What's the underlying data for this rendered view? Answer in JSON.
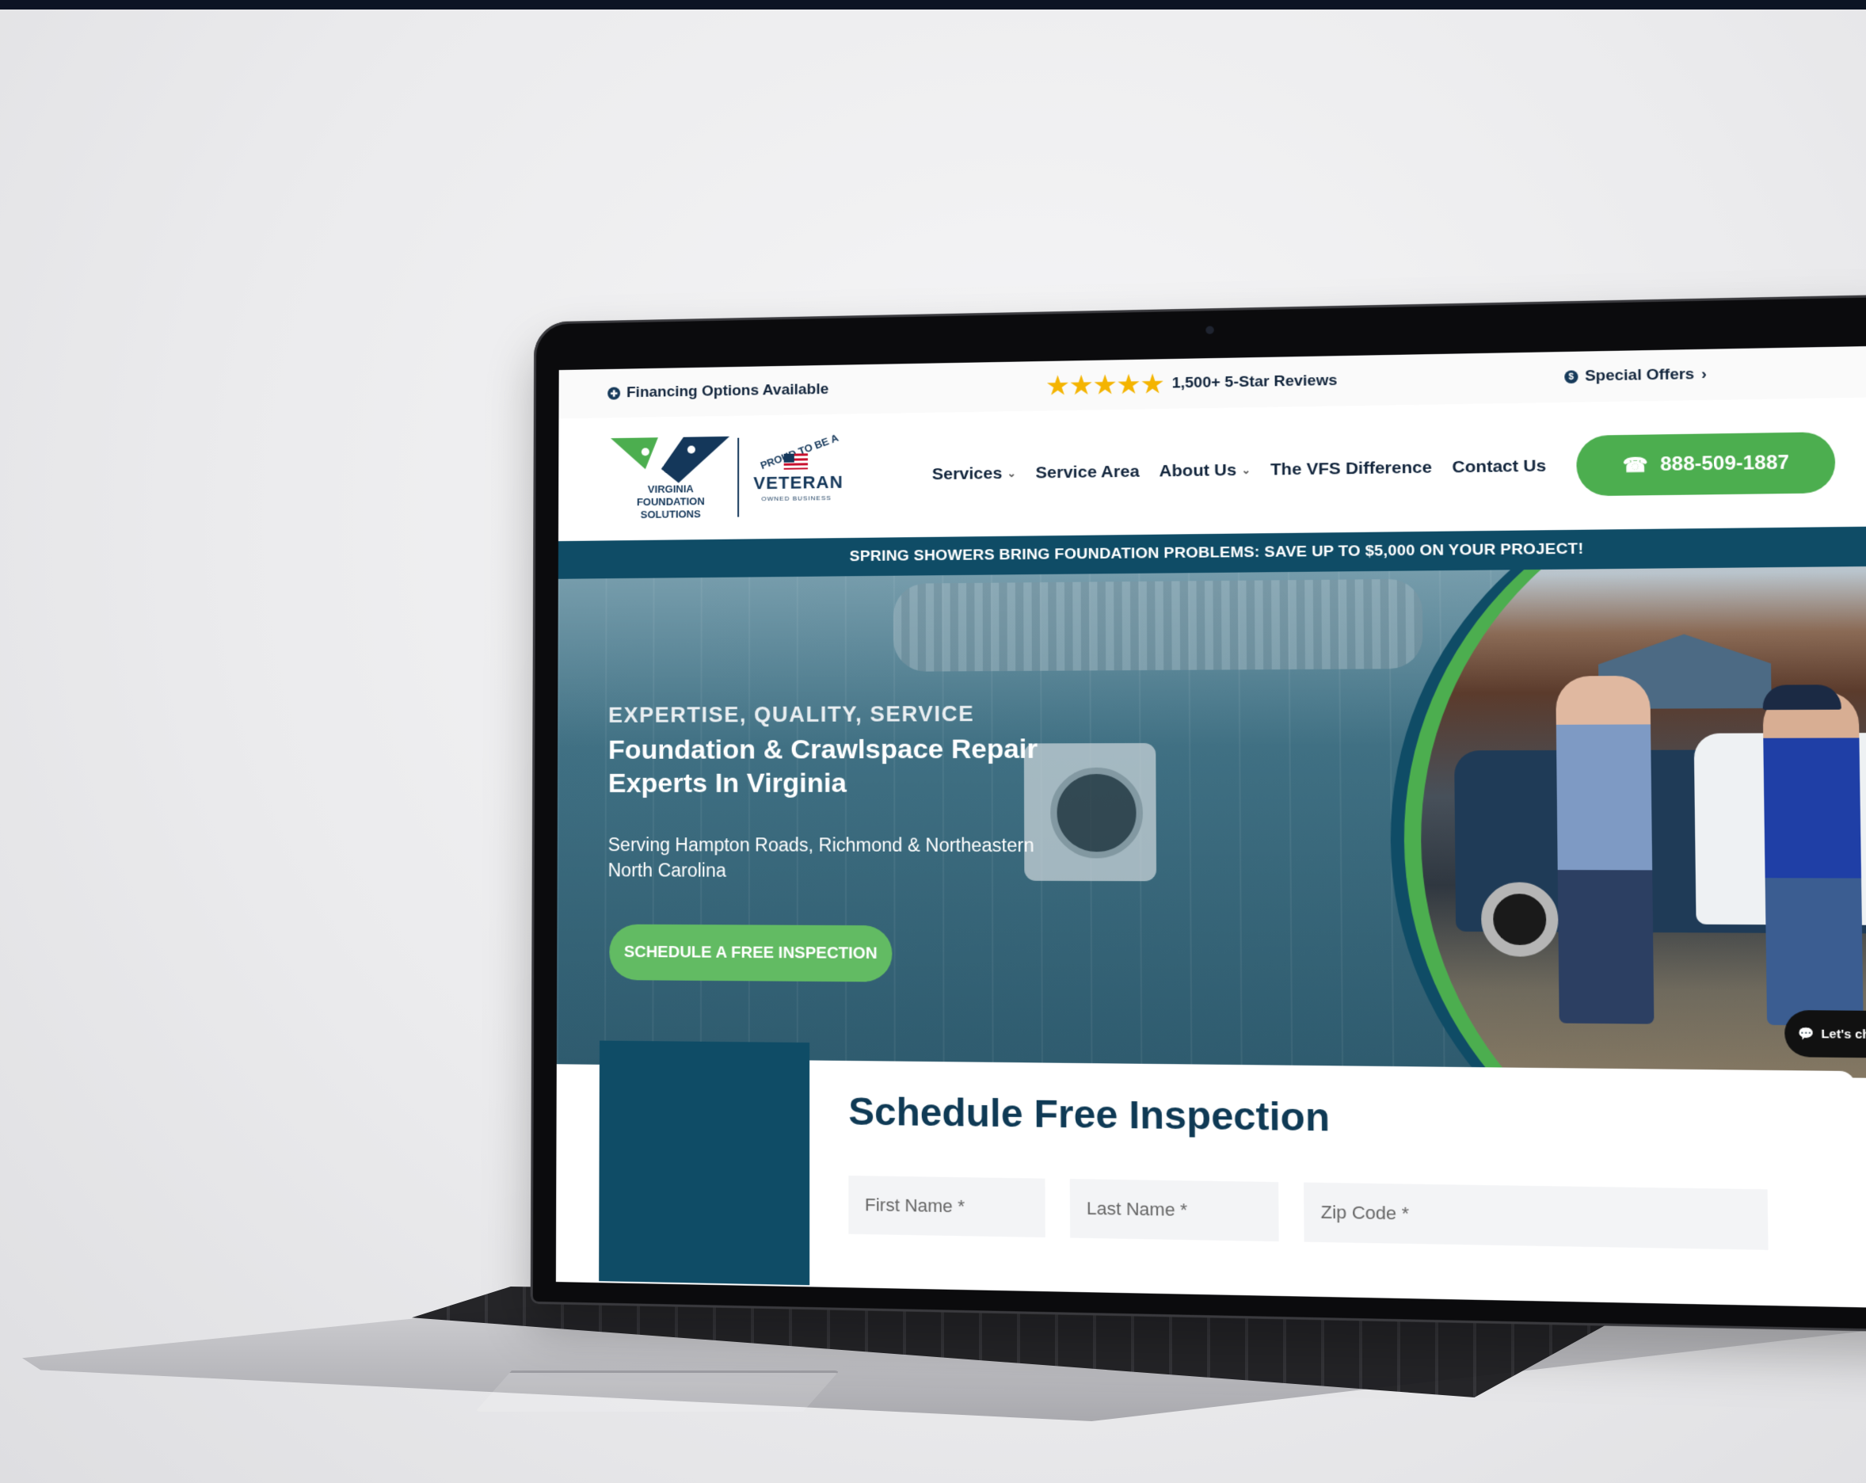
{
  "topbar": {
    "financing": "Financing Options Available",
    "stars": "★★★★★",
    "reviews": "1,500+ 5-Star Reviews",
    "offers": "Special Offers",
    "offers_chevron": "›"
  },
  "logo": {
    "text": "VIRGINIA\nFOUNDATION\nSOLUTIONS",
    "veteran_top": "PROUD TO BE A",
    "veteran_main": "VETERAN",
    "veteran_sub": "OWNED BUSINESS"
  },
  "nav": {
    "items": [
      {
        "label": "Services",
        "dropdown": true
      },
      {
        "label": "Service Area",
        "dropdown": false
      },
      {
        "label": "About Us",
        "dropdown": true
      },
      {
        "label": "The VFS Difference",
        "dropdown": false
      },
      {
        "label": "Contact Us",
        "dropdown": false
      }
    ],
    "chevron": "⌄",
    "phone": "888-509-1887",
    "phone_icon": "☎"
  },
  "promo": "SPRING SHOWERS BRING FOUNDATION PROBLEMS: SAVE UP TO $5,000 ON YOUR PROJECT!",
  "hero": {
    "tag": "EXPERTISE, QUALITY, SERVICE",
    "title": "Foundation & Crawlspace Repair Experts In Virginia",
    "subtitle": "Serving Hampton Roads, Richmond & Northeastern North Carolina",
    "cta": "SCHEDULE A FREE INSPECTION"
  },
  "chat": {
    "label": "Let's chat",
    "icon": "chat-bubble-icon"
  },
  "form": {
    "title": "Schedule Free Inspection",
    "first_name": "First Name *",
    "last_name": "Last Name *",
    "zip": "Zip Code *"
  },
  "colors": {
    "primary_green": "#4cae4f",
    "navy": "#0f4c66",
    "text_dark": "#13263d"
  }
}
